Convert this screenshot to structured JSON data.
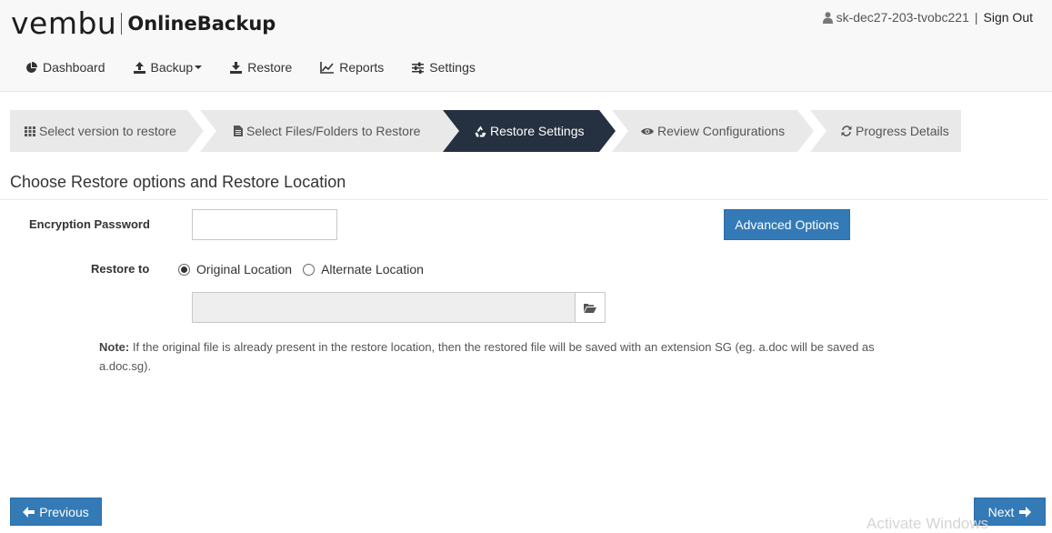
{
  "header": {
    "logo_text": "vembu",
    "product_name": "OnlineBackup",
    "username": "sk-dec27-203-tvobc221",
    "separator": "|",
    "signout_label": "Sign Out"
  },
  "nav": {
    "items": [
      {
        "label": "Dashboard",
        "icon": "pie-chart-icon"
      },
      {
        "label": "Backup",
        "icon": "upload-icon",
        "has_dropdown": true
      },
      {
        "label": "Restore",
        "icon": "download-icon"
      },
      {
        "label": "Reports",
        "icon": "line-chart-icon"
      },
      {
        "label": "Settings",
        "icon": "sliders-icon"
      }
    ]
  },
  "wizard": {
    "steps": [
      {
        "label": "Select version to restore",
        "icon": "grid-icon",
        "active": false
      },
      {
        "label": "Select Files/Folders to Restore",
        "icon": "file-icon",
        "active": false
      },
      {
        "label": "Restore Settings",
        "icon": "recycle-icon",
        "active": true
      },
      {
        "label": "Review Configurations",
        "icon": "eye-icon",
        "active": false
      },
      {
        "label": "Progress Details",
        "icon": "refresh-icon",
        "active": false
      }
    ],
    "active_color": "#253040",
    "inactive_color": "#e9e9e9"
  },
  "main": {
    "title": "Choose Restore options and Restore Location",
    "encryption_label": "Encryption Password",
    "encryption_value": "",
    "advanced_options_label": "Advanced Options",
    "restore_to_label": "Restore to",
    "restore_options": [
      {
        "label": "Original Location",
        "checked": true
      },
      {
        "label": "Alternate Location",
        "checked": false
      }
    ],
    "restore_path_value": "",
    "note_label": "Note:",
    "note_text": " If the original file is already present in the restore location, then the restored file will be saved with an extension SG (eg. a.doc will be saved as a.doc.sg)."
  },
  "footer": {
    "previous_label": "Previous",
    "next_label": "Next"
  },
  "overlay": {
    "watermark": "Activate Windows"
  },
  "colors": {
    "primary": "#337ab7",
    "header_bg": "#f8f8f8"
  }
}
